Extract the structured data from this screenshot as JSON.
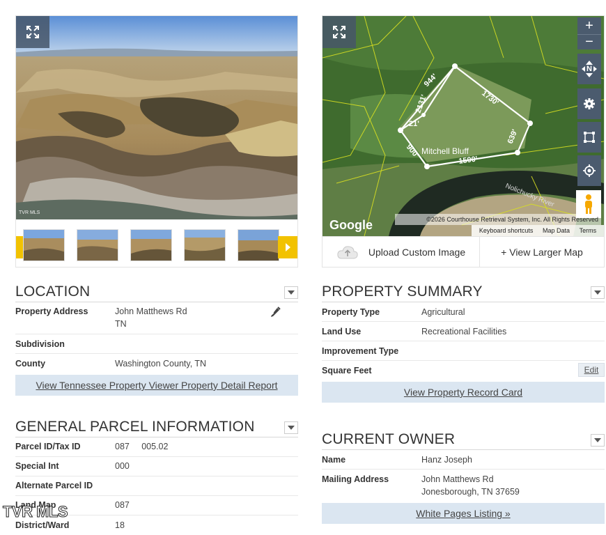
{
  "photo": {
    "mls_mark": "TVR MLS"
  },
  "map": {
    "plot_label": "Mitchell Bluff",
    "river_label": "Nolichucky River",
    "edges": [
      "944'",
      "1730'",
      "639'",
      "1590'",
      "900'",
      "21'",
      "2131'"
    ],
    "google_label": "Google",
    "copyright": "©2026 Courthouse Retrieval System, Inc. All Rights Reserved",
    "keyboard_shortcuts": "Keyboard shortcuts",
    "map_data": "Map Data",
    "terms": "Terms",
    "zoom_in": "+",
    "zoom_out": "−",
    "compass_label": "N",
    "upload_label": "Upload Custom Image",
    "larger_map_label": "+ View Larger Map"
  },
  "location": {
    "title": "LOCATION",
    "rows": [
      {
        "label": "Property Address",
        "value": "John Matthews Rd",
        "value2": "TN"
      },
      {
        "label": "Subdivision",
        "value": ""
      },
      {
        "label": "County",
        "value": "Washington County, TN"
      }
    ],
    "link": "View Tennessee Property Viewer Property Detail Report"
  },
  "summary": {
    "title": "PROPERTY SUMMARY",
    "rows": [
      {
        "label": "Property Type",
        "value": "Agricultural"
      },
      {
        "label": "Land Use",
        "value": "Recreational Facilities"
      },
      {
        "label": "Improvement Type",
        "value": ""
      },
      {
        "label": "Square Feet",
        "value": ""
      }
    ],
    "edit_label": "Edit",
    "link": "View Property Record Card"
  },
  "parcel": {
    "title": "GENERAL PARCEL INFORMATION",
    "rows": [
      {
        "label": "Parcel ID/Tax ID",
        "value": "087     005.02"
      },
      {
        "label": "Special Int",
        "value": "000"
      },
      {
        "label": "Alternate Parcel ID",
        "value": ""
      },
      {
        "label": "Land Map",
        "value": "087"
      },
      {
        "label": "District/Ward",
        "value": "18"
      }
    ]
  },
  "owner": {
    "title": "CURRENT OWNER",
    "rows": [
      {
        "label": "Name",
        "value": "Hanz Joseph"
      },
      {
        "label": "Mailing Address",
        "value": "John Matthews Rd",
        "value2": "Jonesborough, TN 37659"
      }
    ],
    "link": "White Pages Listing »"
  },
  "watermark": "TVR MLS",
  "colors": {
    "link_bar": "#dbe6f1",
    "thumb_arrow": "#f2c200",
    "map_control": "#4b5b6e",
    "parcel_line": "#d9e021"
  }
}
